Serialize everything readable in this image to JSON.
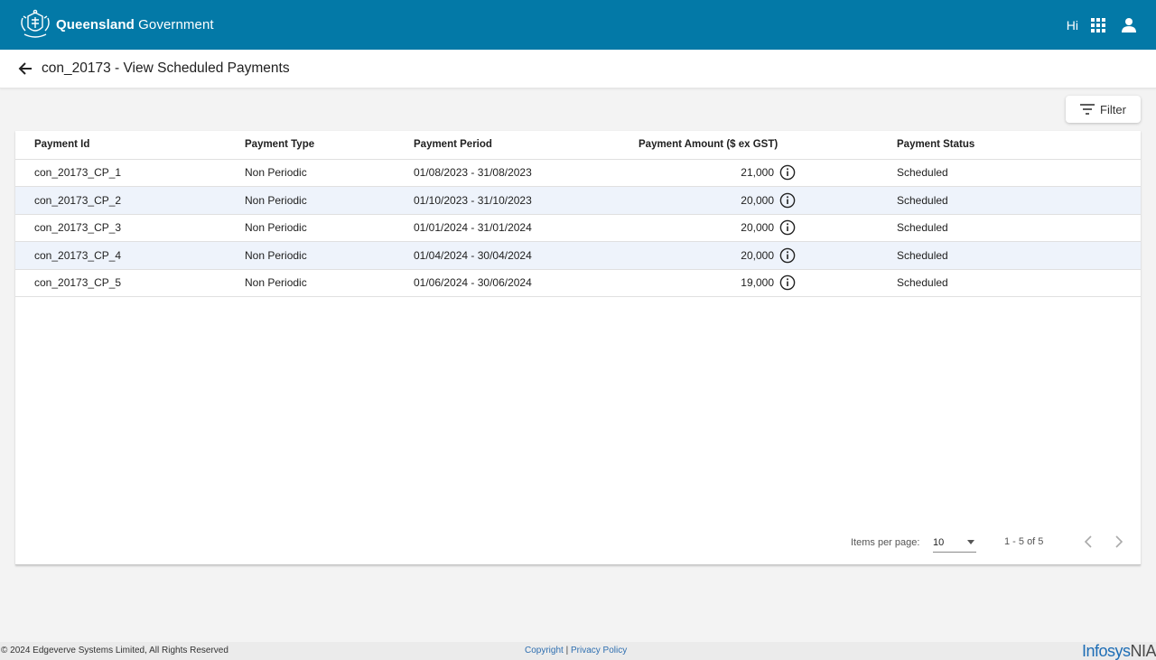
{
  "header": {
    "brand_bold": "Queensland",
    "brand_light": "Government",
    "greeting": "Hi",
    "icons": [
      "crest-logo",
      "apps-grid-icon",
      "account-icon"
    ]
  },
  "titlebar": {
    "title": "con_20173 - View Scheduled Payments",
    "back_icon": "arrow-left-icon"
  },
  "toolbar": {
    "filter_label": "Filter",
    "filter_icon": "filter-lines-icon"
  },
  "table": {
    "columns": [
      "Payment Id",
      "Payment Type",
      "Payment Period",
      "Payment Amount ($ ex GST)",
      "Payment Status"
    ],
    "rows": [
      {
        "id": "con_20173_CP_1",
        "type": "Non Periodic",
        "period": "01/08/2023 - 31/08/2023",
        "amount": "21,000",
        "status": "Scheduled"
      },
      {
        "id": "con_20173_CP_2",
        "type": "Non Periodic",
        "period": "01/10/2023 - 31/10/2023",
        "amount": "20,000",
        "status": "Scheduled"
      },
      {
        "id": "con_20173_CP_3",
        "type": "Non Periodic",
        "period": "01/01/2024 - 31/01/2024",
        "amount": "20,000",
        "status": "Scheduled"
      },
      {
        "id": "con_20173_CP_4",
        "type": "Non Periodic",
        "period": "01/04/2024 - 30/04/2024",
        "amount": "20,000",
        "status": "Scheduled"
      },
      {
        "id": "con_20173_CP_5",
        "type": "Non Periodic",
        "period": "01/06/2024 - 30/06/2024",
        "amount": "19,000",
        "status": "Scheduled"
      }
    ]
  },
  "paginator": {
    "items_per_page_label": "Items per page:",
    "items_per_page_value": "10",
    "range_label": "1 - 5 of 5"
  },
  "footer": {
    "copyright": "© 2024 Edgeverve Systems Limited, All Rights Reserved",
    "link_copyright": "Copyright",
    "separator": "|",
    "link_privacy": "Privacy Policy",
    "logo_main": "Infosys",
    "logo_suffix": "NIA"
  },
  "colors": {
    "header_bg": "#0379a7",
    "row_alt_bg": "#eef3fb",
    "link": "#2f6fb0"
  }
}
